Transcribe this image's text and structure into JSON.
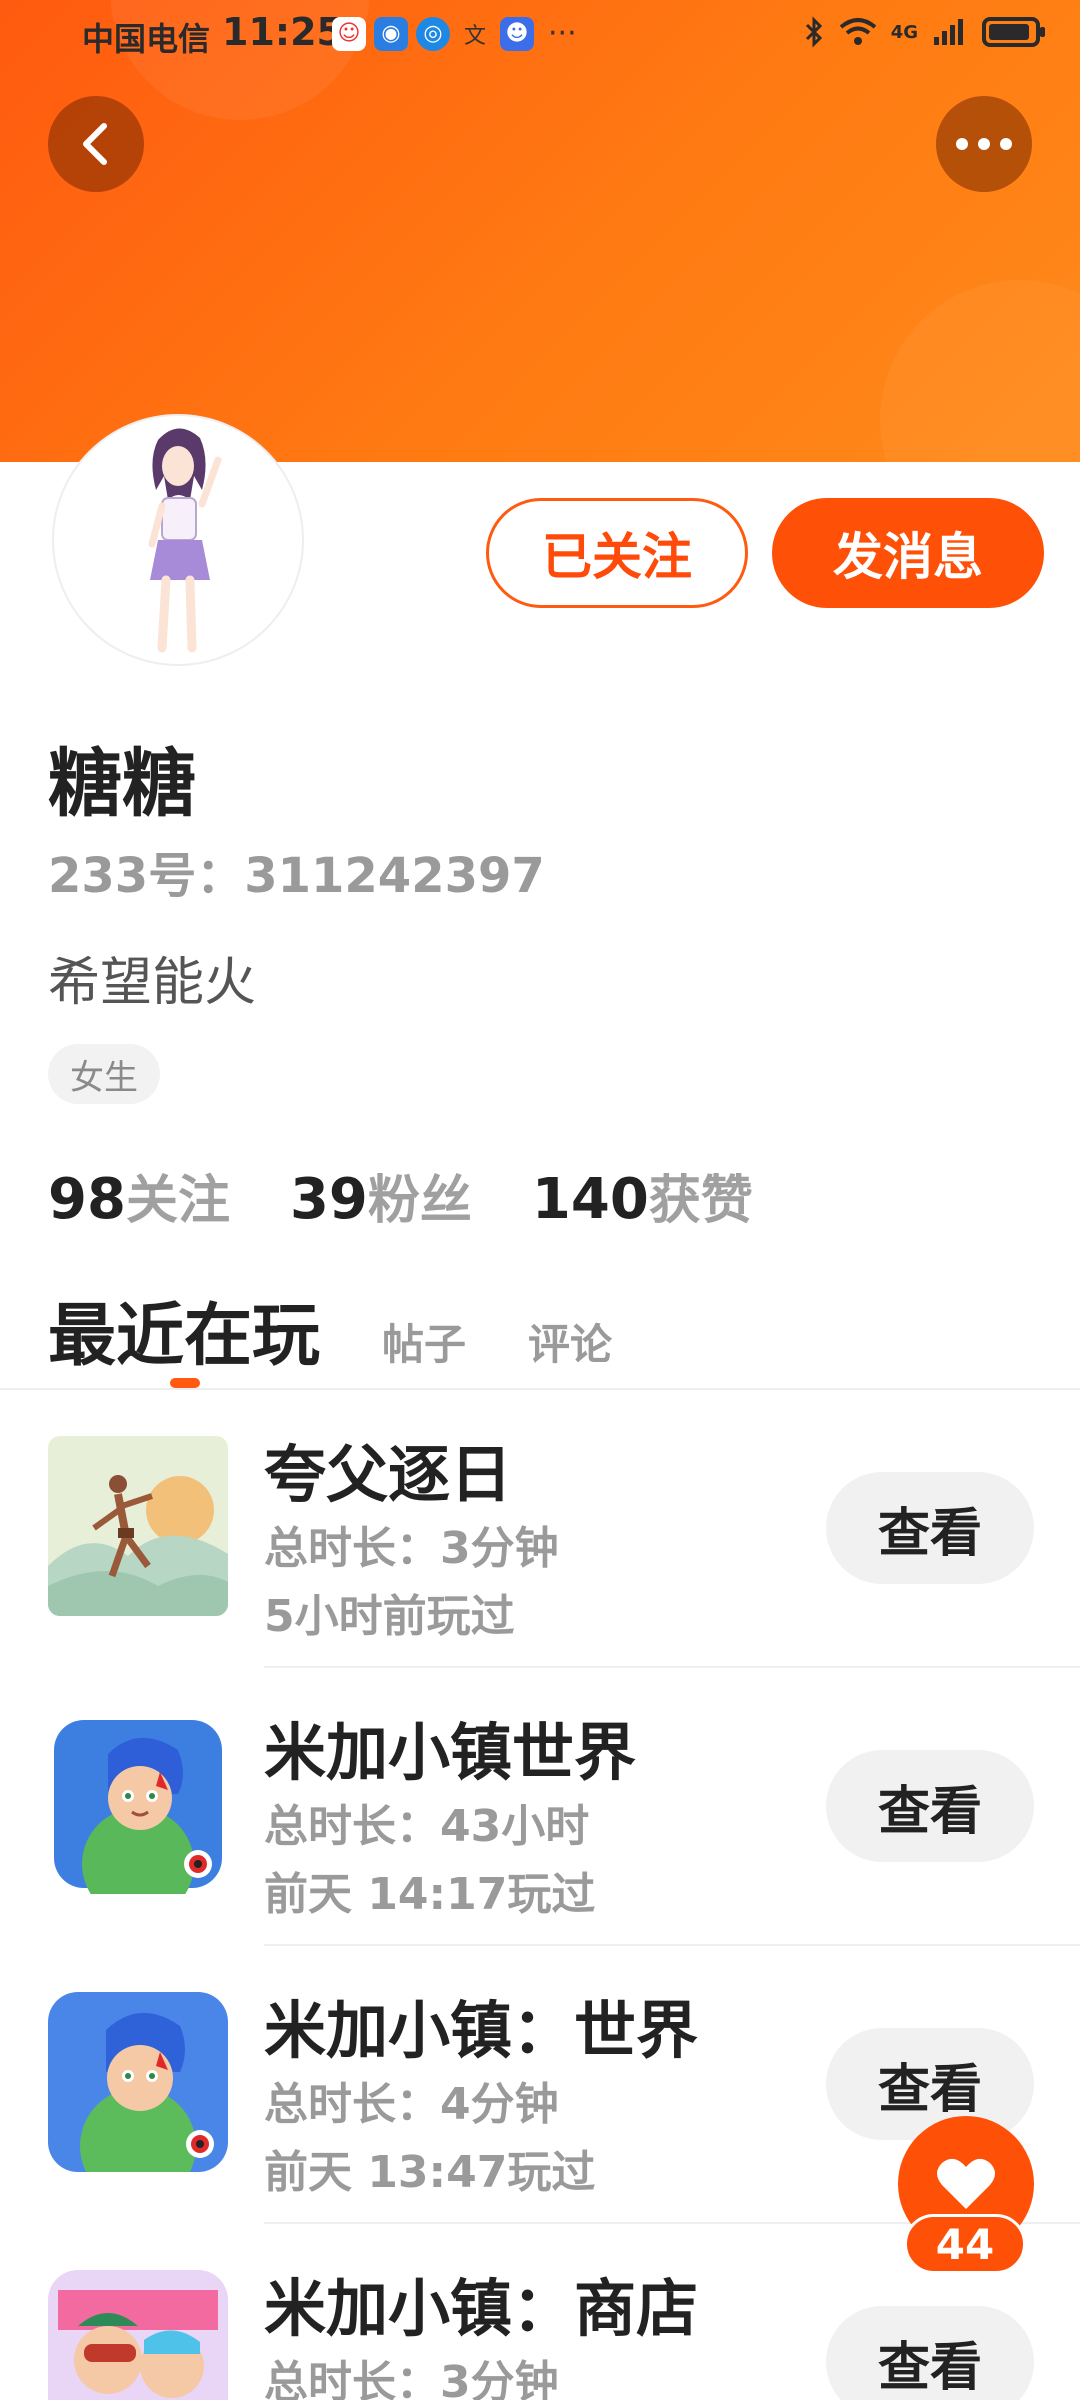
{
  "status_bar": {
    "carrier": "中国电信",
    "time": "11:25",
    "more": "···",
    "network": "4G"
  },
  "header": {
    "back_icon": "chevron-left-icon",
    "more_icon": "more-horizontal-icon"
  },
  "profile": {
    "follow_label": "已关注",
    "message_label": "发消息",
    "nickname": "糖糖",
    "uid": "233号：311242397",
    "bio": "希望能火",
    "tag": "女生"
  },
  "stats": {
    "following_count": "98",
    "following_label": "关注",
    "fans_count": "39",
    "fans_label": "粉丝",
    "likes_count": "140",
    "likes_label": "获赞"
  },
  "tabs": {
    "active": "最近在玩",
    "posts": "帖子",
    "comments": "评论"
  },
  "games": [
    {
      "title": "夸父逐日",
      "duration": "总时长：3分钟",
      "played": "5小时前玩过",
      "action": "查看"
    },
    {
      "title": "米加小镇世界",
      "duration": "总时长：43小时",
      "played": "前天 14:17玩过",
      "action": "查看"
    },
    {
      "title": "米加小镇：世界",
      "duration": "总时长：4分钟",
      "played": "前天 13:47玩过",
      "action": "查看"
    },
    {
      "title": "米加小镇：商店",
      "duration": "总时长：3分钟",
      "played": "",
      "action": "查看"
    }
  ],
  "like_fab": {
    "count": "44",
    "icon": "heart-icon"
  },
  "colors": {
    "accent": "#ff5008",
    "banner": "#ff7a12"
  }
}
